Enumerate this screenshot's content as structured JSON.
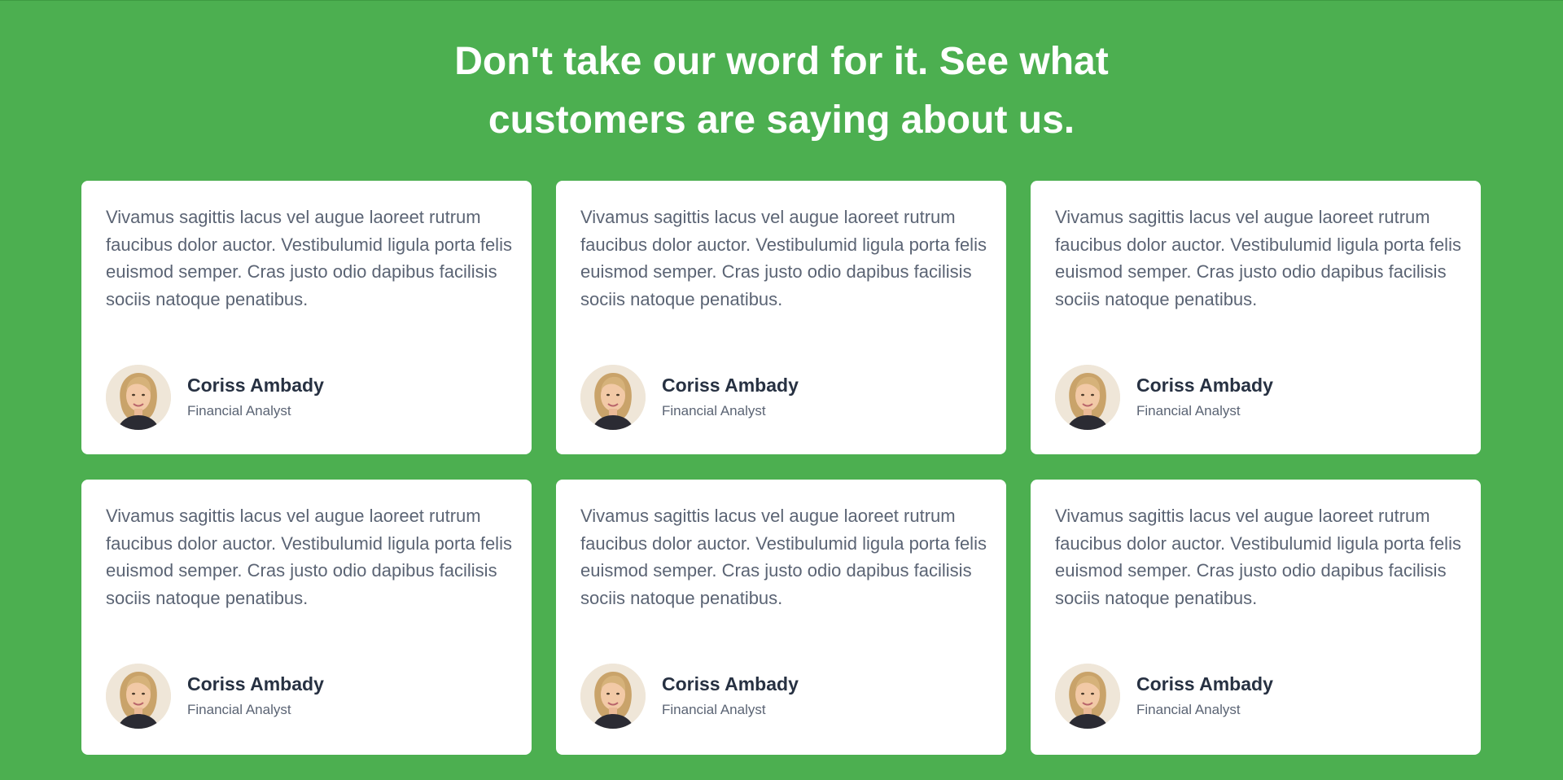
{
  "section": {
    "heading_line1": "Don't take our word for it. See what",
    "heading_line2": "customers are saying about us.",
    "background_color": "#4caf50"
  },
  "testimonials": [
    {
      "quote": "Vivamus sagittis lacus vel augue laoreet rutrum faucibus dolor auctor. Vestibulumid ligula porta felis euismod semper. Cras justo odio dapibus facilisis sociis natoque penatibus.",
      "name": "Coriss Ambady",
      "role": "Financial Analyst",
      "avatar_icon": "person-avatar-icon"
    },
    {
      "quote": "Vivamus sagittis lacus vel augue laoreet rutrum faucibus dolor auctor. Vestibulumid ligula porta felis euismod semper. Cras justo odio dapibus facilisis sociis natoque penatibus.",
      "name": "Coriss Ambady",
      "role": "Financial Analyst",
      "avatar_icon": "person-avatar-icon"
    },
    {
      "quote": "Vivamus sagittis lacus vel augue laoreet rutrum faucibus dolor auctor. Vestibulumid ligula porta felis euismod semper. Cras justo odio dapibus facilisis sociis natoque penatibus.",
      "name": "Coriss Ambady",
      "role": "Financial Analyst",
      "avatar_icon": "person-avatar-icon"
    },
    {
      "quote": "Vivamus sagittis lacus vel augue laoreet rutrum faucibus dolor auctor. Vestibulumid ligula porta felis euismod semper. Cras justo odio dapibus facilisis sociis natoque penatibus.",
      "name": "Coriss Ambady",
      "role": "Financial Analyst",
      "avatar_icon": "person-avatar-icon"
    },
    {
      "quote": "Vivamus sagittis lacus vel augue laoreet rutrum faucibus dolor auctor. Vestibulumid ligula porta felis euismod semper. Cras justo odio dapibus facilisis sociis natoque penatibus.",
      "name": "Coriss Ambady",
      "role": "Financial Analyst",
      "avatar_icon": "person-avatar-icon"
    },
    {
      "quote": "Vivamus sagittis lacus vel augue laoreet rutrum faucibus dolor auctor. Vestibulumid ligula porta felis euismod semper. Cras justo odio dapibus facilisis sociis natoque penatibus.",
      "name": "Coriss Ambady",
      "role": "Financial Analyst",
      "avatar_icon": "person-avatar-icon"
    }
  ]
}
